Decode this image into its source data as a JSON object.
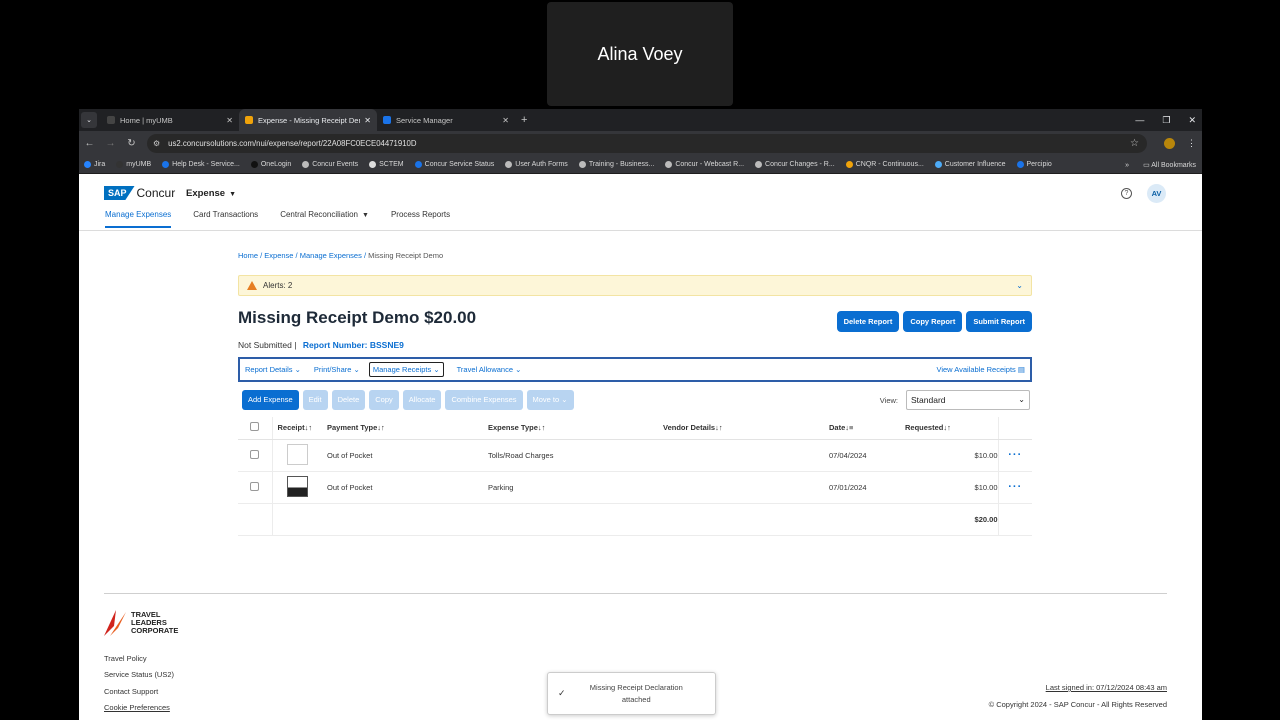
{
  "caller": {
    "name": "Alina Voey"
  },
  "browser": {
    "tabs": [
      {
        "title": "Home | myUMB",
        "color": "#444444"
      },
      {
        "title": "Expense - Missing Receipt Dem",
        "color": "#f0a30a"
      },
      {
        "title": "Service Manager",
        "color": "#1a73e8"
      }
    ],
    "url": "us2.concursolutions.com/nui/expense/report/22A08FC0ECE04471910D",
    "bookmarks": [
      "Jira",
      "myUMB",
      "Help Desk - Service...",
      "OneLogin",
      "Concur Events",
      "SCTEM",
      "Concur Service Status",
      "User Auth Forms",
      "Training - Business...",
      "Concur - Webcast R...",
      "Concur Changes - R...",
      "CNQR - Continuous...",
      "Customer Influence",
      "Percipio"
    ],
    "all_bookmarks": "All Bookmarks"
  },
  "app": {
    "logo_sap": "SAP",
    "logo_concur": "Concur",
    "product": "Expense",
    "avatar": "AV",
    "nav": [
      "Manage Expenses",
      "Card Transactions",
      "Central Reconciliation",
      "Process Reports"
    ]
  },
  "breadcrumb": {
    "home": "Home",
    "expense": "Expense",
    "manage": "Manage Expenses",
    "current": "Missing Receipt Demo"
  },
  "alerts": {
    "label": "Alerts: 2"
  },
  "report": {
    "title": "Missing Receipt Demo $20.00",
    "status": "Not Submitted |",
    "number_label": "Report Number: BSSNE9",
    "actions": [
      "Delete Report",
      "Copy Report",
      "Submit Report"
    ]
  },
  "menu": {
    "report_details": "Report Details",
    "print_share": "Print/Share",
    "manage_receipts": "Manage Receipts",
    "travel_allowance": "Travel Allowance",
    "view_receipts": "View Available Receipts"
  },
  "buttons": {
    "add": "Add Expense",
    "edit": "Edit",
    "delete": "Delete",
    "copy": "Copy",
    "allocate": "Allocate",
    "combine": "Combine Expenses",
    "move": "Move to"
  },
  "view": {
    "label": "View:",
    "value": "Standard"
  },
  "table": {
    "headers": {
      "receipt": "Receipt",
      "payment": "Payment Type",
      "expense": "Expense Type",
      "vendor": "Vendor Details",
      "date": "Date",
      "requested": "Requested"
    },
    "rows": [
      {
        "payment": "Out of Pocket",
        "expense": "Tolls/Road Charges",
        "vendor": "",
        "date": "07/04/2024",
        "amount": "$10.00"
      },
      {
        "payment": "Out of Pocket",
        "expense": "Parking",
        "vendor": "",
        "date": "07/01/2024",
        "amount": "$10.00"
      }
    ],
    "total": "$20.00"
  },
  "footer": {
    "brand": [
      "TRAVEL",
      "LEADERS",
      "CORPORATE"
    ],
    "links": [
      "Travel Policy",
      "Service Status (US2)",
      "Contact Support",
      "Cookie Preferences"
    ],
    "last_signed": "Last signed in: 07/12/2024 08:43 am",
    "copyright": "© Copyright 2024 - SAP Concur - All Rights Reserved"
  },
  "toast": {
    "line1": "Missing Receipt Declaration",
    "line2": "attached"
  }
}
